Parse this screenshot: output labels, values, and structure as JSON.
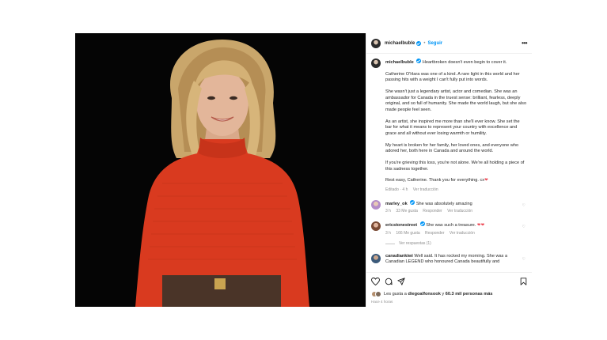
{
  "header": {
    "username": "michaelbuble",
    "separator": "•",
    "follow_label": "Seguir",
    "more_label": "•••"
  },
  "caption": {
    "username": "michaelbuble",
    "paragraphs": [
      "Heartbroken doesn't even begin to cover it.",
      "Catherine O'Hara was one of a kind. A rare light in this world and her passing hits with a weight I can't fully put into words.",
      "She wasn't just a legendary artist, actor and comedian. She was an ambassador for Canada in the truest sense: brilliant, fearless, deeply original, and so full of humanity. She made the world laugh, but she also made people feel seen.",
      "As an artist, she inspired me more than she'll ever know. She set the bar for what it means to represent your country with excellence and grace and all without ever losing warmth or humility.",
      "My heart is broken for her family, her loved ones, and everyone who adored her, both here in Canada and around the world.",
      "If you're grieving this loss, you're not alone. We're all holding a piece of this sadness together.",
      "Rest easy, Catherine. Thank you for everything. cx"
    ],
    "meta": {
      "edited": "Editado · 4 h",
      "translate": "Ver traducción"
    }
  },
  "comments": [
    {
      "username": "marley_ok",
      "text": "She was absolutely amazing",
      "time": "3 h",
      "likes": "33 Me gusta",
      "reply": "Responder",
      "translate": "Ver traducción"
    },
    {
      "username": "ericstonestreet",
      "text": "She was such a treasure.",
      "time": "3 h",
      "likes": "166 Me gusta",
      "reply": "Responder",
      "translate": "Ver traducción",
      "replies_label": "Ver respuestas (1)"
    },
    {
      "username": "canadiankiwi",
      "text": "Well said. It has rocked my morning. She was a Canadian LEGEND who honoured Canada beautifully and"
    }
  ],
  "footer": {
    "likes_prefix": "Les gusta a",
    "likes_user": "diegoalfonsook",
    "likes_suffix": "y",
    "likes_others": "60.3 mil personas más",
    "time_ago": "Hace 4 horas"
  },
  "colors": {
    "accent": "#0095f6",
    "heart": "#ed4956",
    "sweater": "#d93a1f",
    "photo_bg": "#000000"
  },
  "icons": [
    "verified-icon",
    "more-icon",
    "heart-icon",
    "comment-icon",
    "share-icon",
    "save-icon"
  ]
}
